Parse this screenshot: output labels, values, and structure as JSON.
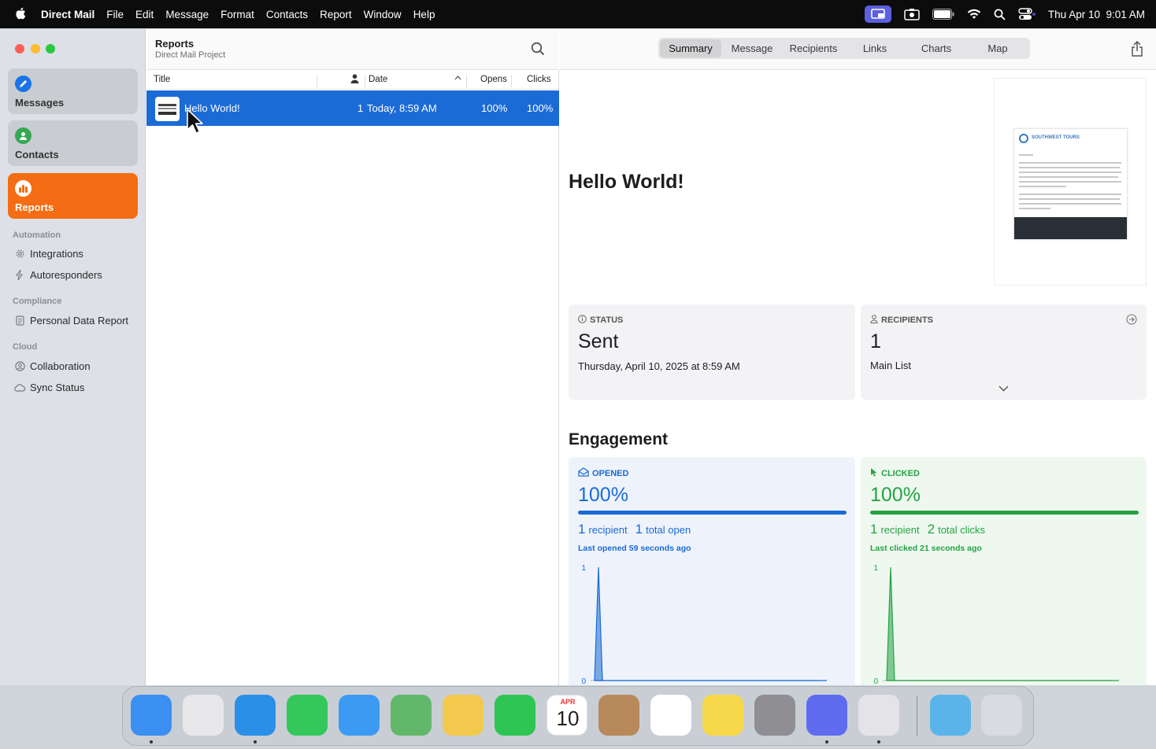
{
  "menubar": {
    "app_name": "Direct Mail",
    "menus": [
      "File",
      "Edit",
      "Message",
      "Format",
      "Contacts",
      "Report",
      "Window",
      "Help"
    ],
    "datetime": "Thu Apr 10  9:01 AM"
  },
  "sidebar": {
    "nav": [
      {
        "label": "Messages",
        "icon": "pencil-icon",
        "color": "#1a73e8"
      },
      {
        "label": "Contacts",
        "icon": "person-icon",
        "color": "#34a853"
      },
      {
        "label": "Reports",
        "icon": "chart-icon",
        "color": "#f46d14"
      }
    ],
    "sections": [
      {
        "title": "Automation",
        "items": [
          {
            "label": "Integrations",
            "icon": "gear-icon"
          },
          {
            "label": "Autoresponders",
            "icon": "bolt-icon"
          }
        ]
      },
      {
        "title": "Compliance",
        "items": [
          {
            "label": "Personal Data Report",
            "icon": "document-icon"
          }
        ]
      },
      {
        "title": "Cloud",
        "items": [
          {
            "label": "Collaboration",
            "icon": "person-circle-icon"
          },
          {
            "label": "Sync Status",
            "icon": "cloud-icon"
          }
        ]
      }
    ]
  },
  "list": {
    "title": "Reports",
    "subtitle": "Direct Mail Project",
    "columns": {
      "title": "Title",
      "date": "Date",
      "opens": "Opens",
      "clicks": "Clicks"
    },
    "rows": [
      {
        "title": "Hello World!",
        "recipients": "1",
        "date": "Today, 8:59 AM",
        "opens": "100%",
        "clicks": "100%"
      }
    ]
  },
  "detail": {
    "tabs": [
      "Summary",
      "Message",
      "Recipients",
      "Links",
      "Charts",
      "Map"
    ],
    "active_tab": "Summary",
    "message_title": "Hello World!",
    "preview_brand": "SOUTHWEST TOURS",
    "status": {
      "label": "STATUS",
      "value": "Sent",
      "date": "Thursday, April 10, 2025 at 8:59 AM"
    },
    "recipients": {
      "label": "RECIPIENTS",
      "value": "1",
      "list": "Main List"
    },
    "engagement_title": "Engagement",
    "opened": {
      "label": "OPENED",
      "percent": "100%",
      "recipients_n": "1",
      "recipients_label": "recipient",
      "total_n": "1",
      "total_label": "total open",
      "last": "Last opened 59 seconds ago",
      "color": "#1a6ad6"
    },
    "clicked": {
      "label": "CLICKED",
      "percent": "100%",
      "recipients_n": "1",
      "recipients_label": "recipient",
      "total_n": "2",
      "total_label": "total clicks",
      "last": "Last clicked 21 seconds ago",
      "color": "#25a244"
    }
  },
  "chart_data": [
    {
      "type": "area",
      "series": [
        {
          "values": [
            0,
            1,
            0,
            0,
            0,
            0,
            0,
            0,
            0,
            0,
            0,
            0,
            0,
            0,
            0,
            0,
            0,
            0,
            0,
            0,
            0,
            0,
            0,
            0,
            0,
            0,
            0,
            0,
            0,
            0,
            0,
            0,
            0,
            0,
            0,
            0,
            0,
            0,
            0,
            0,
            0,
            0,
            0,
            0,
            0,
            0,
            0,
            0,
            0,
            0,
            0,
            0,
            0,
            0,
            0,
            0,
            0,
            0,
            0,
            0
          ]
        }
      ],
      "ylim": [
        0,
        1
      ],
      "yticks": [
        "0",
        "1"
      ],
      "color": "#1a6ad6"
    },
    {
      "type": "area",
      "series": [
        {
          "values": [
            0,
            1,
            0,
            0,
            0,
            0,
            0,
            0,
            0,
            0,
            0,
            0,
            0,
            0,
            0,
            0,
            0,
            0,
            0,
            0,
            0,
            0,
            0,
            0,
            0,
            0,
            0,
            0,
            0,
            0,
            0,
            0,
            0,
            0,
            0,
            0,
            0,
            0,
            0,
            0,
            0,
            0,
            0,
            0,
            0,
            0,
            0,
            0,
            0,
            0,
            0,
            0,
            0,
            0,
            0,
            0,
            0,
            0,
            0,
            0
          ]
        }
      ],
      "ylim": [
        0,
        1
      ],
      "yticks": [
        "0",
        "1"
      ],
      "color": "#25a244"
    }
  ],
  "dock": {
    "apps": [
      {
        "name": "finder-icon",
        "color": "#3b8ff0",
        "running": true
      },
      {
        "name": "launchpad-icon",
        "color": "#e8e8ea",
        "running": false
      },
      {
        "name": "safari-icon",
        "color": "#2b8fe8",
        "running": true
      },
      {
        "name": "messages-icon",
        "color": "#34c759",
        "running": false
      },
      {
        "name": "mail-icon",
        "color": "#3d9af2",
        "running": false
      },
      {
        "name": "maps-icon",
        "color": "#62b86a",
        "running": false
      },
      {
        "name": "photos-icon",
        "color": "#f2c94c",
        "running": false
      },
      {
        "name": "facetime-icon",
        "color": "#2fc553",
        "running": false
      },
      {
        "name": "calendar-icon",
        "color": "#ffffff",
        "running": false,
        "month": "APR",
        "day": "10"
      },
      {
        "name": "contacts-icon",
        "color": "#b8895a",
        "running": false
      },
      {
        "name": "reminders-icon",
        "color": "#ffffff",
        "running": false
      },
      {
        "name": "notes-icon",
        "color": "#f7d84a",
        "running": false
      },
      {
        "name": "system-settings-icon",
        "color": "#8e8e93",
        "running": false
      },
      {
        "name": "direct-mail-icon",
        "color": "#5f6cf0",
        "running": true
      },
      {
        "name": "photo-slideshow-icon",
        "color": "#e4e4e8",
        "running": true
      },
      {
        "name": "downloads-folder-icon",
        "color": "#5ab4ea",
        "running": false
      },
      {
        "name": "trash-icon",
        "color": "#d8dce0",
        "running": false
      }
    ]
  }
}
